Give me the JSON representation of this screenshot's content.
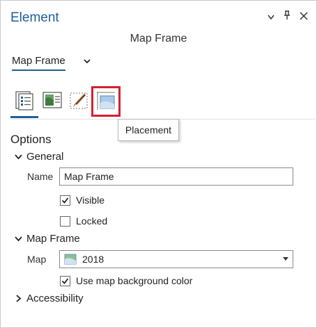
{
  "window": {
    "title": "Element",
    "controls": {
      "dropdown": "▾",
      "pin": "📌",
      "close": "✕"
    }
  },
  "subtitle": "Map Frame",
  "element_selector": {
    "value": "Map Frame"
  },
  "tabs": [
    {
      "name": "tab-options",
      "icon": "properties-list-icon",
      "selected": true
    },
    {
      "name": "tab-display",
      "icon": "map-display-icon",
      "selected": false
    },
    {
      "name": "tab-symbol",
      "icon": "brush-icon",
      "selected": false
    },
    {
      "name": "tab-placement",
      "icon": "placement-icon",
      "selected": false,
      "highlighted": true
    }
  ],
  "tooltip": "Placement",
  "options": {
    "heading": "Options",
    "general": {
      "label": "General",
      "name_label": "Name",
      "name_value": "Map Frame",
      "visible": {
        "label": "Visible",
        "checked": true
      },
      "locked": {
        "label": "Locked",
        "checked": false
      }
    },
    "map_frame": {
      "label": "Map Frame",
      "map_label": "Map",
      "map_value": "2018",
      "use_bg": {
        "label": "Use map background color",
        "checked": true
      }
    },
    "accessibility": {
      "label": "Accessibility"
    }
  },
  "colors": {
    "accent": "#1f5f97",
    "highlight": "#d3202f"
  }
}
